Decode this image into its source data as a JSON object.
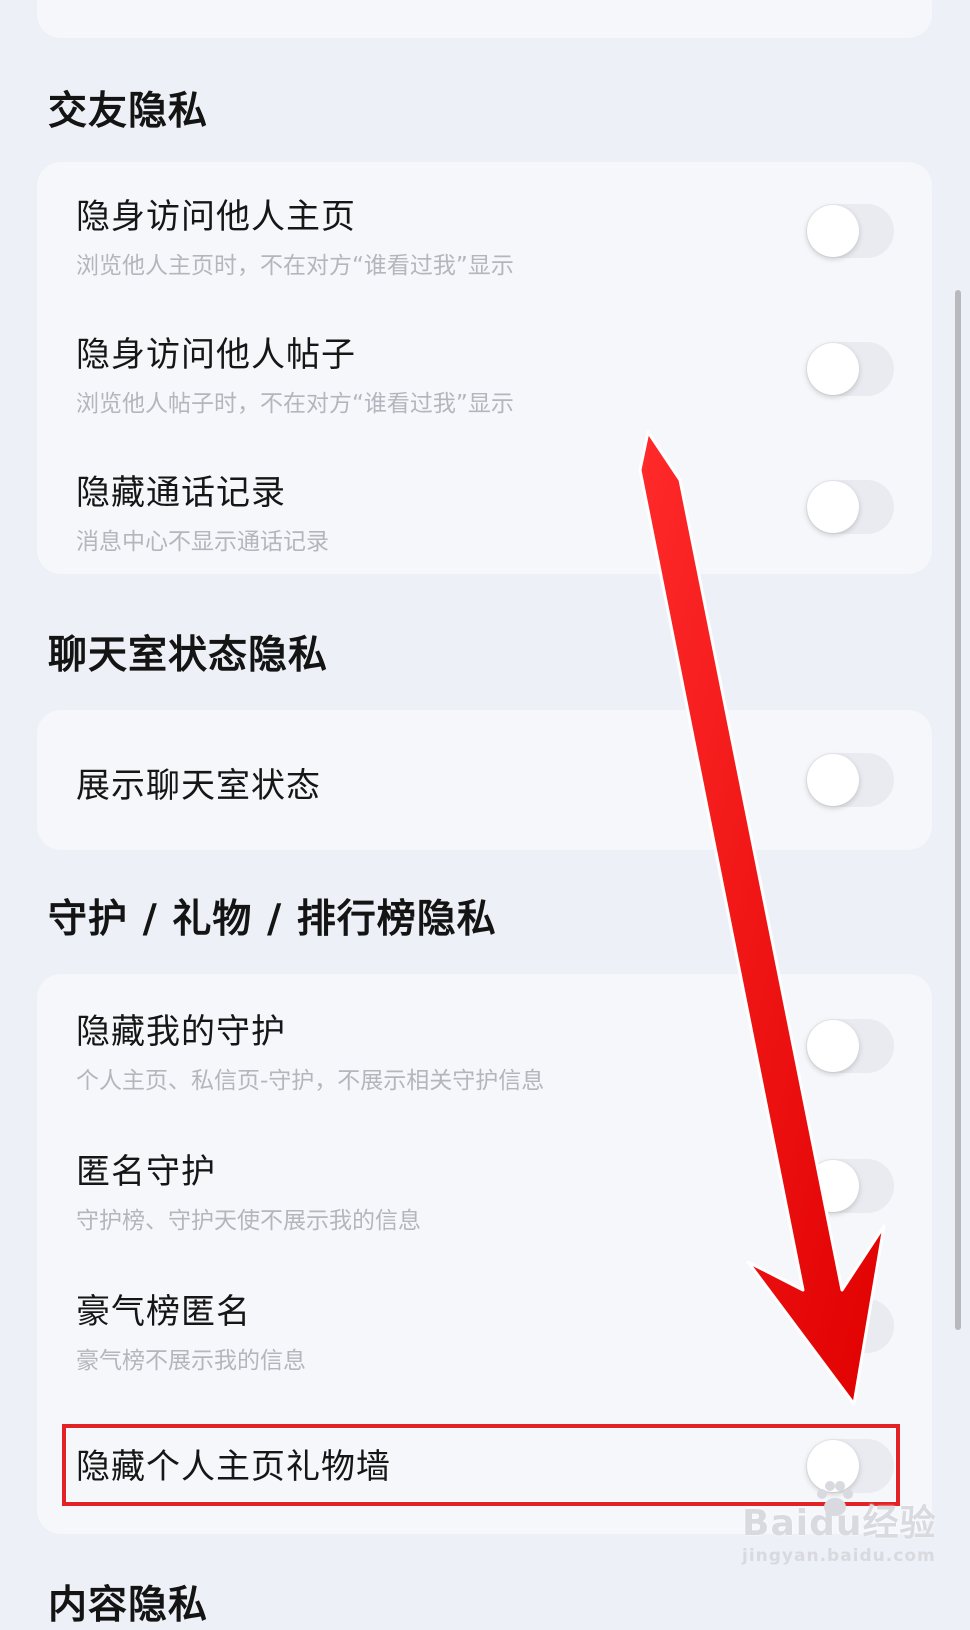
{
  "sections": [
    {
      "title": "交友隐私",
      "items": [
        {
          "title": "隐身访问他人主页",
          "subtitle": "浏览他人主页时，不在对方“谁看过我”显示",
          "on": false
        },
        {
          "title": "隐身访问他人帖子",
          "subtitle": "浏览他人帖子时，不在对方“谁看过我”显示",
          "on": false
        },
        {
          "title": "隐藏通话记录",
          "subtitle": "消息中心不显示通话记录",
          "on": false
        }
      ]
    },
    {
      "title": "聊天室状态隐私",
      "items": [
        {
          "title": "展示聊天室状态",
          "on": false
        }
      ]
    },
    {
      "title": "守护 / 礼物 / 排行榜隐私",
      "items": [
        {
          "title": "隐藏我的守护",
          "subtitle": "个人主页、私信页-守护，不展示相关守护信息",
          "on": false
        },
        {
          "title": "匿名守护",
          "subtitle": "守护榜、守护天使不展示我的信息",
          "on": false
        },
        {
          "title": "豪气榜匿名",
          "subtitle": "豪气榜不展示我的信息",
          "on": false
        },
        {
          "title": "隐藏个人主页礼物墙",
          "on": false
        }
      ]
    },
    {
      "title": "内容隐私"
    }
  ],
  "watermark": {
    "brand": "Baidu经验",
    "url": "jingyan.baidu.com"
  },
  "colors": {
    "annotation_red": "#e32226",
    "page_bg": "#edf0f6",
    "card_bg": "#f6f7fb",
    "toggle_off": "#e9ebf0"
  }
}
